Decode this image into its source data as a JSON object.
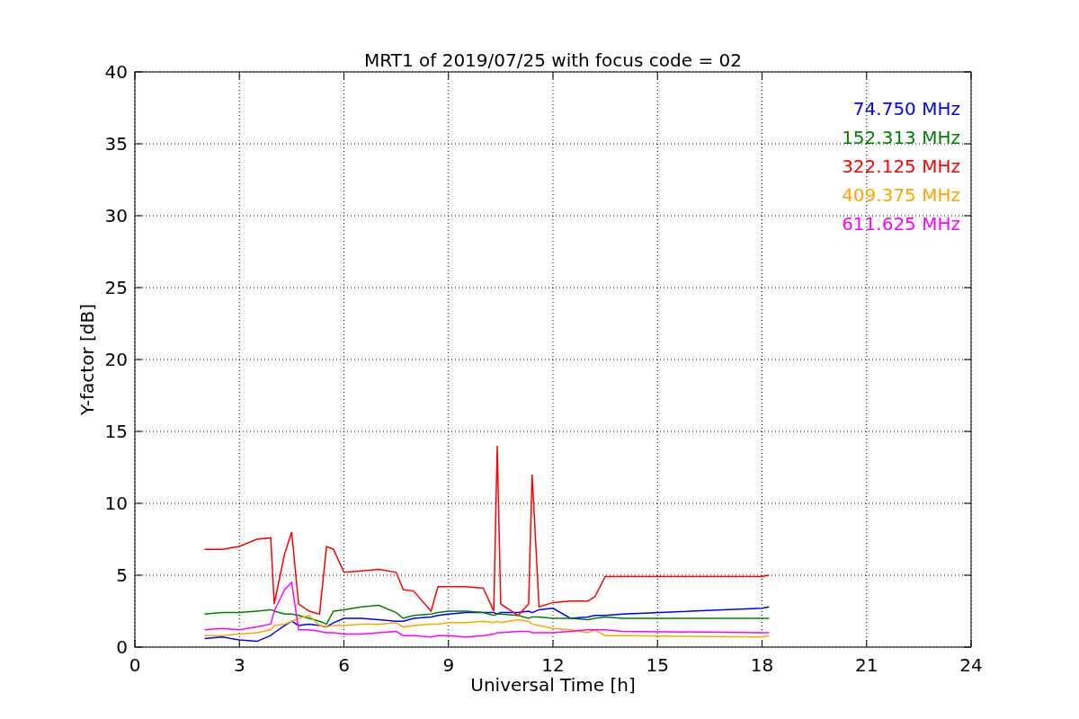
{
  "chart_data": {
    "type": "line",
    "title": "MRT1 of 2019/07/25 with focus code = 02",
    "xlabel": "Universal Time [h]",
    "ylabel": "Y-factor [dB]",
    "x": [
      2,
      2.5,
      3,
      3.5,
      3.9,
      4,
      4.3,
      4.5,
      4.7,
      5,
      5.3,
      5.5,
      5.7,
      6,
      6.5,
      7,
      7.5,
      7.7,
      8,
      8.5,
      8.7,
      9,
      9.5,
      10,
      10.3,
      10.4,
      10.5,
      11,
      11.3,
      11.4,
      11.6,
      12,
      12.5,
      13,
      13.2,
      13.5,
      14,
      18,
      18.2
    ],
    "grid": true,
    "xlim": [
      0,
      24
    ],
    "ylim": [
      0,
      40
    ],
    "xticks": [
      0,
      3,
      6,
      9,
      12,
      15,
      18,
      21,
      24
    ],
    "yticks": [
      0,
      5,
      10,
      15,
      20,
      25,
      30,
      35,
      40
    ],
    "series": [
      {
        "name": "74.750 MHz",
        "color": "#0000ff",
        "values": [
          0.6,
          0.7,
          0.5,
          0.4,
          0.8,
          1.0,
          1.5,
          1.8,
          1.5,
          1.6,
          1.5,
          1.4,
          1.7,
          2.0,
          2.0,
          1.9,
          1.8,
          1.8,
          2.0,
          2.1,
          2.2,
          2.3,
          2.4,
          2.4,
          2.4,
          2.3,
          2.4,
          2.4,
          2.5,
          2.4,
          2.6,
          2.7,
          2.0,
          2.1,
          2.2,
          2.2,
          2.3,
          2.7,
          2.8
        ]
      },
      {
        "name": "152.313 MHz",
        "color": "#008000",
        "values": [
          2.3,
          2.4,
          2.4,
          2.5,
          2.6,
          2.5,
          2.3,
          2.3,
          2.2,
          2.0,
          1.8,
          1.6,
          2.5,
          2.6,
          2.8,
          2.9,
          2.4,
          2.0,
          2.2,
          2.3,
          2.4,
          2.5,
          2.5,
          2.4,
          2.2,
          2.3,
          2.3,
          2.2,
          2.0,
          2.1,
          2.1,
          2.0,
          2.0,
          1.9,
          2.0,
          2.1,
          2.0,
          2.0,
          2.0
        ]
      },
      {
        "name": "322.125 MHz",
        "color": "#ff0000",
        "values": [
          6.8,
          6.8,
          7.0,
          7.5,
          7.6,
          3.0,
          6.5,
          8.0,
          3.0,
          2.5,
          2.3,
          7.0,
          6.8,
          5.2,
          5.3,
          5.4,
          5.2,
          4.0,
          3.9,
          2.5,
          4.2,
          4.2,
          4.2,
          4.1,
          2.5,
          14,
          3,
          2.2,
          3,
          12,
          2.8,
          3.1,
          3.2,
          3.2,
          3.5,
          4.9,
          4.9,
          4.9,
          5.0
        ]
      },
      {
        "name": "409.375 MHz",
        "color": "#ffa500",
        "values": [
          0.8,
          0.8,
          0.9,
          1.0,
          1.2,
          1.5,
          1.6,
          1.8,
          2.0,
          2.2,
          1.5,
          1.4,
          1.5,
          1.5,
          1.6,
          1.6,
          1.7,
          1.4,
          1.5,
          1.6,
          1.6,
          1.7,
          1.7,
          1.8,
          1.7,
          1.8,
          1.7,
          1.9,
          1.8,
          1.6,
          1.5,
          1.3,
          1.2,
          1.0,
          1.2,
          0.8,
          0.8,
          0.7,
          0.8
        ]
      },
      {
        "name": "611.625 MHz",
        "color": "#ff00ff",
        "values": [
          1.2,
          1.3,
          1.2,
          1.4,
          1.6,
          2.5,
          4.0,
          4.5,
          1.2,
          1.2,
          1.1,
          1.0,
          1.0,
          0.9,
          0.9,
          1.0,
          1.1,
          0.8,
          0.8,
          0.7,
          0.8,
          0.8,
          0.7,
          0.8,
          0.9,
          1.0,
          1.0,
          1.1,
          1.1,
          1.0,
          1.0,
          1.0,
          1.1,
          1.2,
          1.2,
          1.2,
          1.1,
          1.0,
          1.0
        ]
      }
    ]
  }
}
